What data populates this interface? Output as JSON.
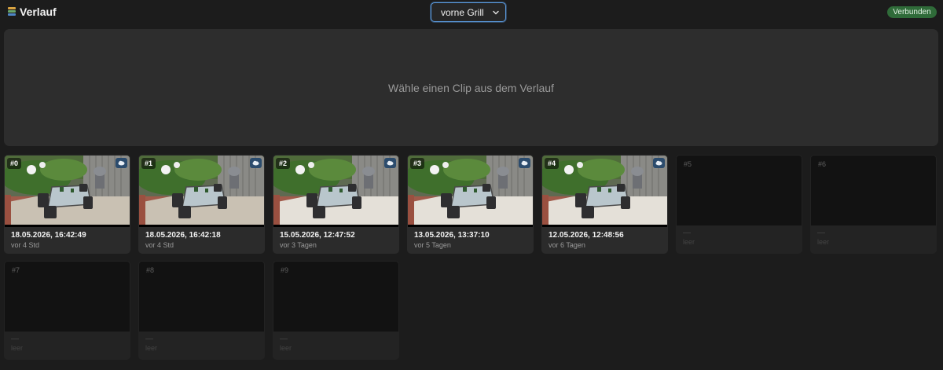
{
  "header": {
    "title": "Verlauf",
    "camera_selected": "vorne Grill",
    "status": "Verbunden"
  },
  "player": {
    "hint": "Wähle einen Clip aus dem Verlauf"
  },
  "clips": [
    {
      "index": "#0",
      "date": "18.05.2026, 16:42:49",
      "ago": "vor 4 Std"
    },
    {
      "index": "#1",
      "date": "18.05.2026, 16:42:18",
      "ago": "vor 4 Std"
    },
    {
      "index": "#2",
      "date": "15.05.2026, 12:47:52",
      "ago": "vor 3 Tagen"
    },
    {
      "index": "#3",
      "date": "13.05.2026, 13:37:10",
      "ago": "vor 5 Tagen"
    },
    {
      "index": "#4",
      "date": "12.05.2026, 12:48:56",
      "ago": "vor 6 Tagen"
    },
    {
      "index": "#5",
      "date": "—",
      "ago": "leer"
    },
    {
      "index": "#6",
      "date": "—",
      "ago": "leer"
    },
    {
      "index": "#7",
      "date": "—",
      "ago": "leer"
    },
    {
      "index": "#8",
      "date": "—",
      "ago": "leer"
    },
    {
      "index": "#9",
      "date": "—",
      "ago": "leer"
    }
  ],
  "colors": {
    "background": "#1c1c1c",
    "status_badge": "#2f6b39",
    "select_border": "#5b9be0",
    "cloud_badge": "#2c4c6d"
  },
  "icons": {
    "app": "app-icon",
    "dropdown": "chevron-down-icon",
    "cloud": "cloud-icon"
  }
}
